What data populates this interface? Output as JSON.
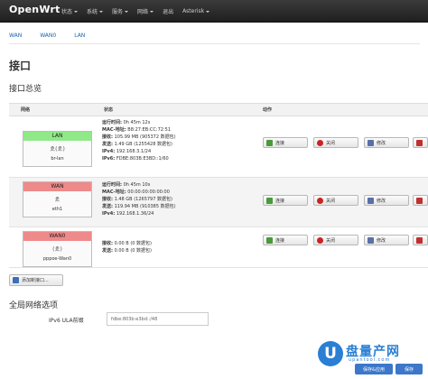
{
  "navbar": {
    "brand": "OpenWrt",
    "menu": [
      "状态",
      "系统",
      "服务",
      "网络",
      "退出",
      "Asterisk"
    ]
  },
  "subtabs": [
    "WAN",
    "WAN0",
    "LAN"
  ],
  "page": {
    "title": "接口",
    "section": "接口总览"
  },
  "table": {
    "headers": {
      "network": "网络",
      "status": "状态",
      "actions": "动作"
    },
    "actions": {
      "reconnect": "连接",
      "shutdown": "关闭",
      "edit": "修改"
    },
    "rows": [
      {
        "name": "LAN",
        "status_color": "#90e888",
        "icons": "ゑ(ゑ)",
        "device": "br-lan",
        "lines": [
          {
            "k": "运行时间:",
            "v": " 0h 45m 12s"
          },
          {
            "k": "MAC-地址:",
            "v": " B8:27:EB:CC:72:51"
          },
          {
            "k": "接收:",
            "v": " 105.99 MB (905372 数据包)"
          },
          {
            "k": "发送:",
            "v": " 1.49 GB (1255428 数据包)"
          },
          {
            "k": "IPv4:",
            "v": " 192.168.3.1/24"
          },
          {
            "k": "IPv6:",
            "v": " FDBE:803B:E3BD::1/60"
          }
        ]
      },
      {
        "name": "WAN",
        "status_color": "#ef8a8a",
        "icons": "ゑ",
        "device": "eth1",
        "lines": [
          {
            "k": "运行时间:",
            "v": " 0h 45m 10s"
          },
          {
            "k": "MAC-地址:",
            "v": " 00:00:00:00:00:00"
          },
          {
            "k": "接收:",
            "v": " 1.48 GB (1265797 数据包)"
          },
          {
            "k": "发送:",
            "v": " 119.94 MB (910385 数据包)"
          },
          {
            "k": "IPv4:",
            "v": " 192.168.1.36/24"
          }
        ]
      },
      {
        "name": "WAN0",
        "status_color": "#ef8a8a",
        "icons": "(ゑ)",
        "device": "pppoe-Wan0",
        "lines": [
          {
            "k": "接收:",
            "v": " 0.00 B (0 数据包)"
          },
          {
            "k": "发送:",
            "v": " 0.00 B (0 数据包)"
          }
        ]
      }
    ]
  },
  "add_button": "添加新接口...",
  "global": {
    "title": "全局网络选项",
    "ula_label": "IPv6 ULA前缀",
    "ula_value": "fdbe:803b:e3bd::/48"
  },
  "watermark": {
    "logo": "U",
    "title": "盘量产网",
    "sub": "upantool.com"
  },
  "footer": {
    "save_apply": "保存&应用",
    "save": "保存"
  }
}
